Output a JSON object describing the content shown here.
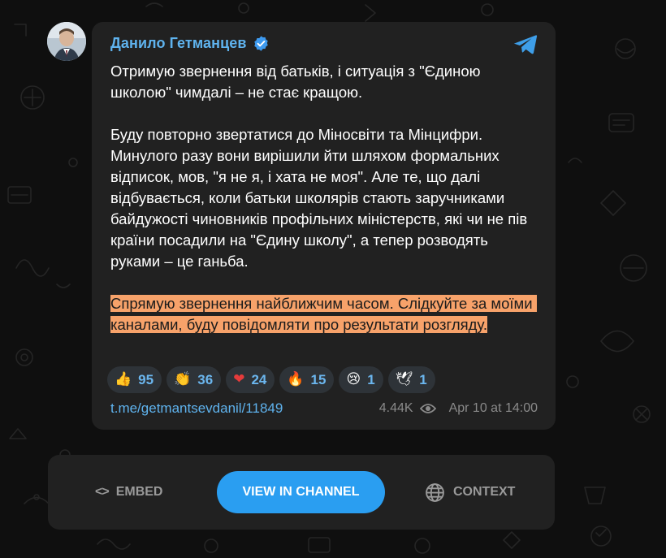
{
  "post": {
    "author_name": "Данило Гетманцев",
    "paragraph_1": "Отримую звернення від батьків, і ситуація з \"Єдиною школою\" чимдалі – не стає кращою.",
    "paragraph_2": "Буду повторно звертатися до Міносвіти та Мінцифри. Минулого разу вони вирішили йти шляхом формальних відписок, мов, \"я не я, і хата не моя\". Але те, що далі відбувається, коли батьки школярів стають заручниками байдужості чиновників профільних міністерств, які чи не пів країни посадили на \"Єдину школу\", а тепер розводять руками – це ганьба.",
    "paragraph_3": "Спрямую звернення найближчим часом. Слідкуйте за моїми каналами, буду повідомляти про результати розгляду.",
    "highlight_color": "#f7a26a",
    "link": "t.me/getmantsevdanil/11849",
    "views": "4.44K",
    "date": "Apr 10 at 14:00",
    "reactions": [
      {
        "emoji": "👍",
        "count": "95"
      },
      {
        "emoji": "👏",
        "count": "36"
      },
      {
        "emoji": "❤",
        "count": "24"
      },
      {
        "emoji": "🔥",
        "count": "15"
      },
      {
        "emoji": "😢",
        "count": "1"
      },
      {
        "emoji": "🕊",
        "count": "1"
      }
    ]
  },
  "actions": {
    "embed_label": "EMBED",
    "view_label": "VIEW IN CHANNEL",
    "context_label": "CONTEXT"
  },
  "icons": {
    "verified": "verified-badge-icon",
    "telegram": "telegram-plane-icon",
    "views": "eye-icon",
    "embed": "code-icon",
    "context": "globe-icon"
  },
  "colors": {
    "background": "#0f0f0f",
    "card": "#212121",
    "accent": "#2a9ef1",
    "link": "#5fb3ee",
    "reaction_bg": "#2e3338"
  }
}
